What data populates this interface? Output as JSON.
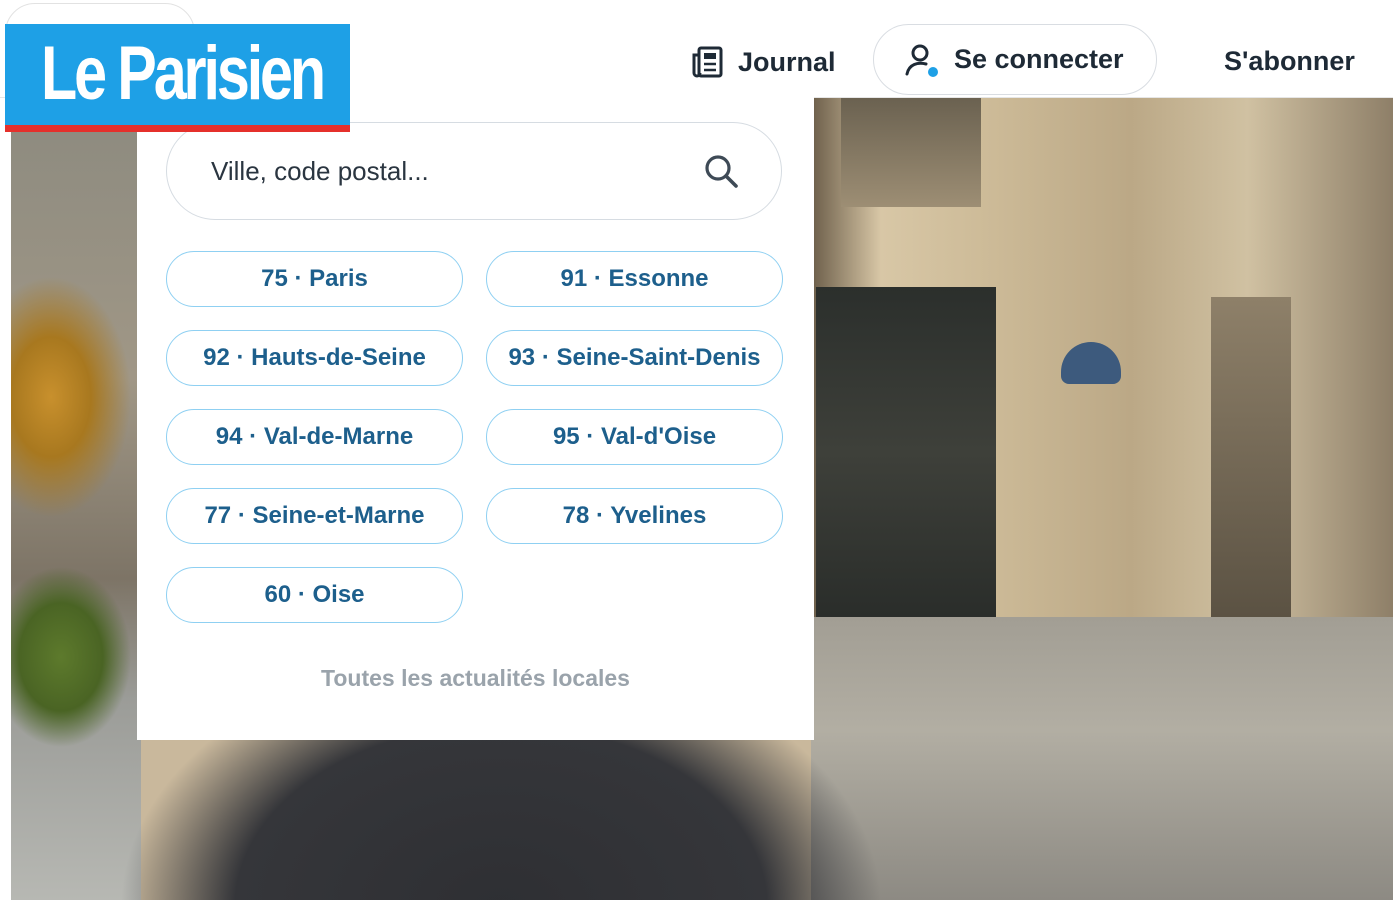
{
  "header": {
    "logo_text": "Le Parisien",
    "nav": {
      "journal_label": "Journal",
      "connect_label": "Se connecter",
      "subscribe_label": "S'abonner"
    }
  },
  "local_menu": {
    "search": {
      "placeholder": "Ville, code postal...",
      "value": ""
    },
    "departments": [
      {
        "label": "75 · Paris"
      },
      {
        "label": "91 · Essonne"
      },
      {
        "label": "92 · Hauts-de-Seine"
      },
      {
        "label": "93 · Seine-Saint-Denis"
      },
      {
        "label": "94 · Val-de-Marne"
      },
      {
        "label": "95 · Val-d'Oise"
      },
      {
        "label": "77 · Seine-et-Marne"
      },
      {
        "label": "78 · Yvelines"
      },
      {
        "label": "60 · Oise"
      }
    ],
    "all_local_label": "Toutes les actualités locales"
  },
  "colors": {
    "brand_blue": "#1ea0e6",
    "brand_red": "#e5302b",
    "button_border": "#8fd0f2",
    "button_text": "#1d5f8c",
    "status_dot": "#1ea0e6"
  },
  "icons": {
    "journal": "newspaper-icon",
    "connect": "user-icon",
    "search": "search-icon"
  }
}
